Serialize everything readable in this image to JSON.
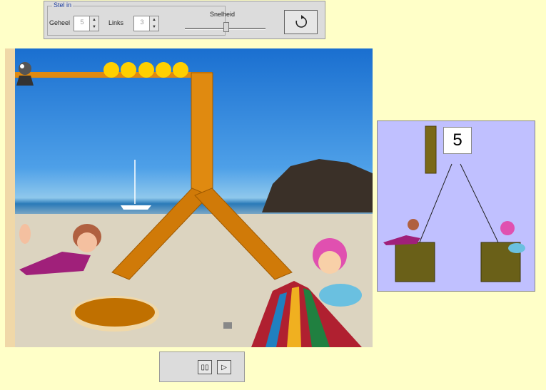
{
  "settings": {
    "group_label": "Stel in",
    "total_label": "Geheel",
    "total_value": "5",
    "left_label": "Links",
    "left_value": "3",
    "speed_label": "Snelheid",
    "speed_level": 0.5,
    "reset_icon": "refresh-icon"
  },
  "diagram": {
    "count": "5"
  },
  "controls": {
    "pause_icon": "pause-icon",
    "play_icon": "play-icon"
  },
  "colors": {
    "background": "#ffffc8",
    "panel": "#dcdcdc",
    "diagram_bg": "#c0c0ff",
    "tube": "#e08a10",
    "ball": "#ffd000"
  }
}
